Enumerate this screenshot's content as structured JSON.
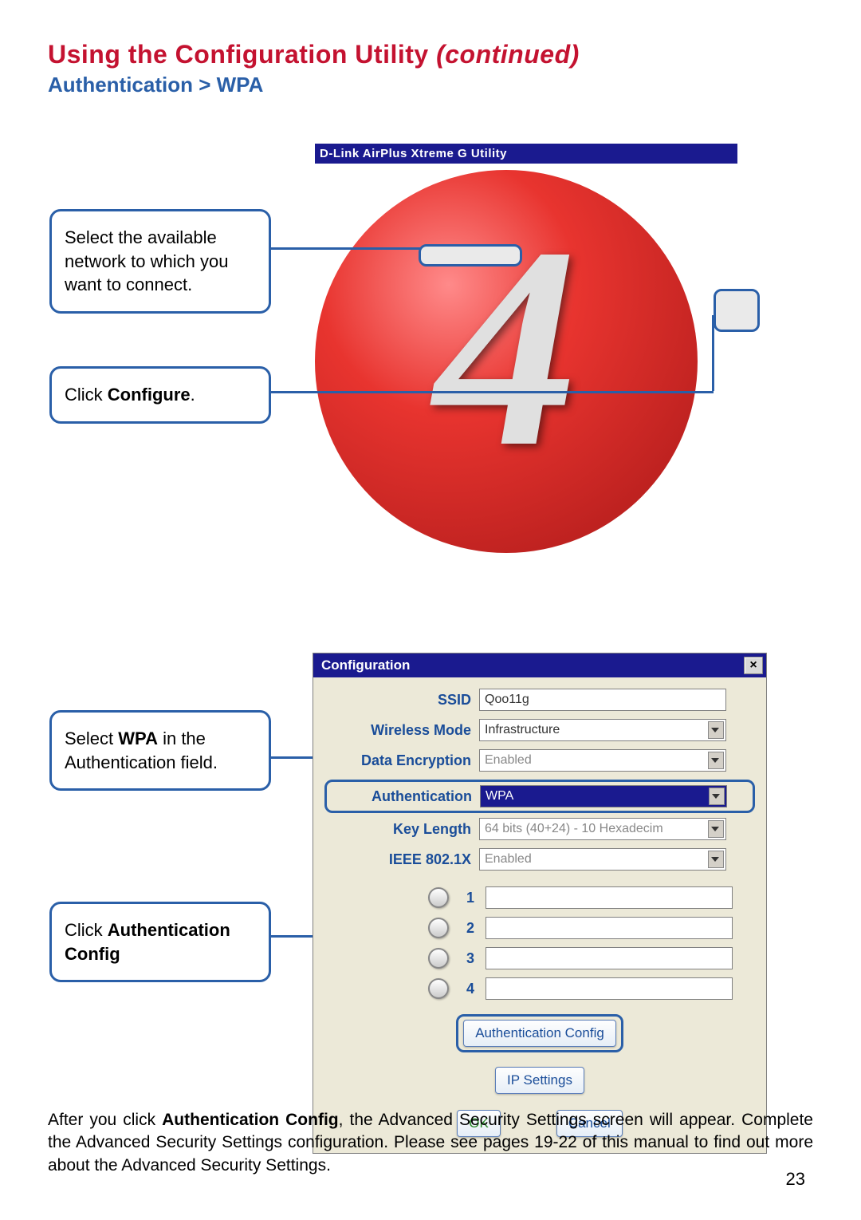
{
  "title_main": "Using the Configuration Utility ",
  "title_ital": "(continued)",
  "subtitle": "Authentication > WPA",
  "callouts": {
    "c1": "Select the available network to which you want to connect.",
    "c2_pre": "Click ",
    "c2_bold": "Configure",
    "c2_post": ".",
    "c3_pre": "Select ",
    "c3_bold": "WPA",
    "c3_post": " in the Authentication field.",
    "c4_pre": "Click ",
    "c4_bold": "Authentication Config"
  },
  "upper_app": {
    "titlebar": "D-Link AirPlus Xtreme G Utility",
    "big_glyph": "4"
  },
  "config": {
    "titlebar": "Configuration",
    "close": "×",
    "fields": {
      "ssid_label": "SSID",
      "ssid_value": "Qoo11g",
      "wmode_label": "Wireless Mode",
      "wmode_value": "Infrastructure",
      "denc_label": "Data Encryption",
      "denc_value": "Enabled",
      "auth_label": "Authentication",
      "auth_value": "WPA",
      "klen_label": "Key Length",
      "klen_value": "64 bits (40+24) - 10 Hexadecim",
      "ieee_label": "IEEE 802.1X",
      "ieee_value": "Enabled"
    },
    "key_nums": [
      "1",
      "2",
      "3",
      "4"
    ],
    "buttons": {
      "auth_config": "Authentication Config",
      "ip_settings": "IP Settings",
      "ok": "OK",
      "cancel": "Cancel"
    }
  },
  "footer_pre": "After you click ",
  "footer_bold": "Authentication Config",
  "footer_post": ", the Advanced Security Settings screen will appear. Complete the Advanced Security Settings configuration. Please see pages 19-22 of this manual to find out more about the Advanced Security Settings.",
  "page_number": "23"
}
